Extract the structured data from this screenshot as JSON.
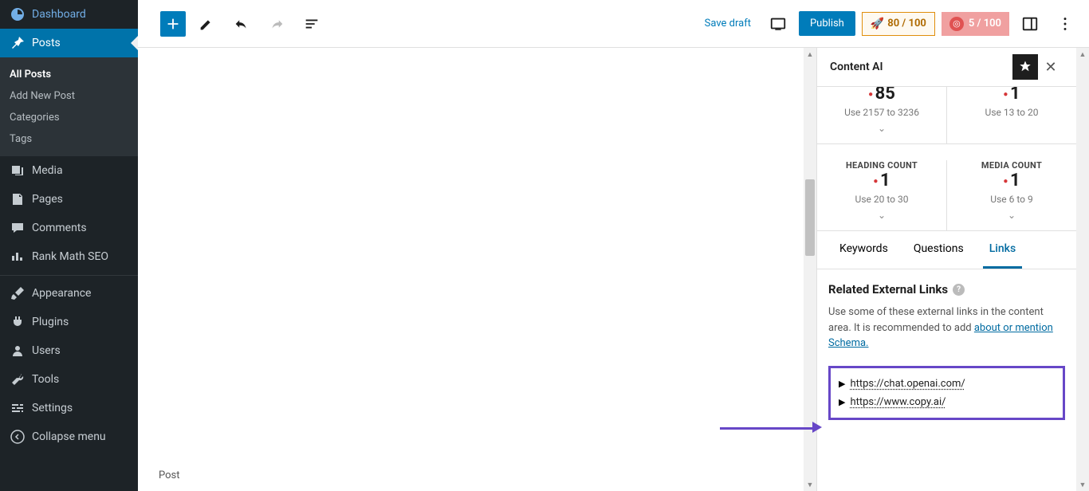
{
  "sidebar": {
    "dashboard": "Dashboard",
    "posts": "Posts",
    "all_posts": "All Posts",
    "add_new_post": "Add New Post",
    "categories": "Categories",
    "tags": "Tags",
    "media": "Media",
    "pages": "Pages",
    "comments": "Comments",
    "rank_math": "Rank Math SEO",
    "appearance": "Appearance",
    "plugins": "Plugins",
    "users": "Users",
    "tools": "Tools",
    "settings": "Settings",
    "collapse": "Collapse menu"
  },
  "topbar": {
    "save_draft": "Save draft",
    "publish": "Publish",
    "score1": "80 / 100",
    "score2": "5 / 100"
  },
  "editor": {
    "post_type": "Post"
  },
  "panel": {
    "title": "Content AI",
    "metric1_value": "85",
    "metric1_hint": "Use 2157 to 3236",
    "metric2_value": "1",
    "metric2_hint": "Use 13 to 20",
    "metric3_label": "HEADING COUNT",
    "metric3_value": "1",
    "metric3_hint": "Use 20 to 30",
    "metric4_label": "MEDIA COUNT",
    "metric4_value": "1",
    "metric4_hint": "Use 6 to 9",
    "tab_keywords": "Keywords",
    "tab_questions": "Questions",
    "tab_links": "Links",
    "links_title": "Related External Links",
    "links_desc1": "Use some of these external links in the content area. It is recommended to add ",
    "links_desc_link": "about or mention Schema.",
    "link1": "https://chat.openai.com/",
    "link2": "https://www.copy.ai/"
  }
}
